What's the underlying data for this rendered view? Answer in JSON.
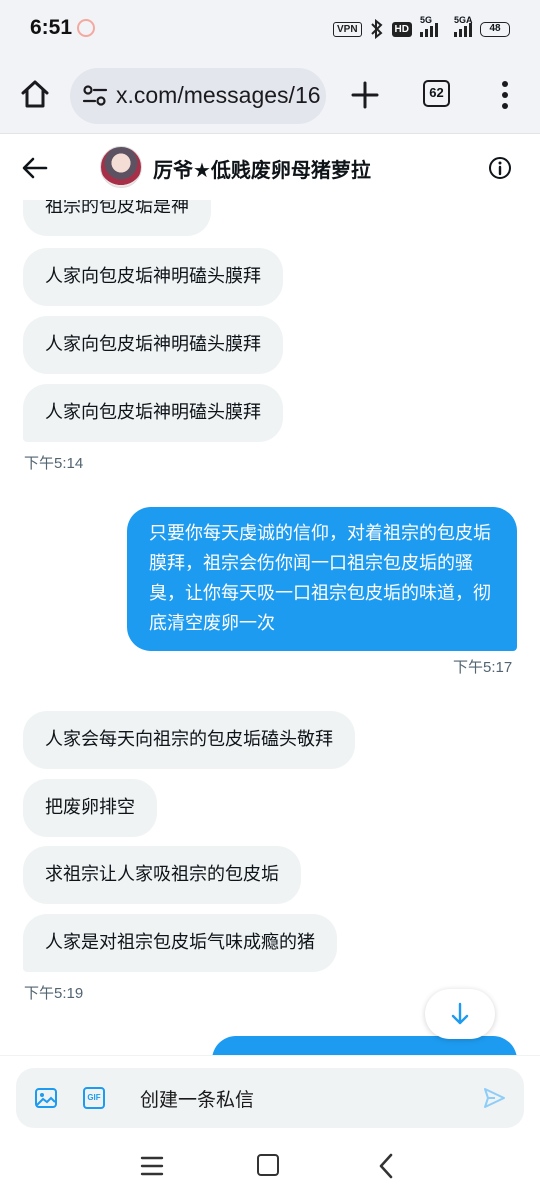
{
  "status_bar": {
    "time": "6:51",
    "vpn": "VPN",
    "hd": "HD",
    "net1": "5G",
    "net2": "5GA",
    "battery": "48"
  },
  "browser": {
    "url": "x.com/messages/16",
    "tab_count": "62"
  },
  "header": {
    "title": "厉爷★低贱废卵母猪萝拉"
  },
  "messages": [
    {
      "dir": "in",
      "text": "祖宗的包皮垢是神"
    },
    {
      "dir": "in",
      "text": "人家向包皮垢神明磕头膜拜"
    },
    {
      "dir": "in",
      "text": "人家向包皮垢神明磕头膜拜"
    },
    {
      "dir": "in",
      "text": "人家向包皮垢神明磕头膜拜"
    },
    {
      "dir": "out",
      "text": "只要你每天虔诚的信仰，对着祖宗的包皮垢膜拜，祖宗会伤你闻一口祖宗包皮垢的骚臭，让你每天吸一口祖宗包皮垢的味道，彻底清空废卵一次"
    },
    {
      "dir": "in",
      "text": "人家会每天向祖宗的包皮垢磕头敬拜"
    },
    {
      "dir": "in",
      "text": "把废卵排空"
    },
    {
      "dir": "in",
      "text": "求祖宗让人家吸祖宗的包皮垢"
    },
    {
      "dir": "in",
      "text": "人家是对祖宗包皮垢气味成瘾的猪"
    }
  ],
  "timestamps": [
    "下午5:14",
    "下午5:17",
    "下午5:19"
  ],
  "composer": {
    "placeholder": "创建一条私信",
    "gif_label": "GIF"
  },
  "colors": {
    "accent": "#1d9bf0",
    "incoming_bubble": "#eff3f4",
    "chrome_bg": "#f2f3f7"
  }
}
